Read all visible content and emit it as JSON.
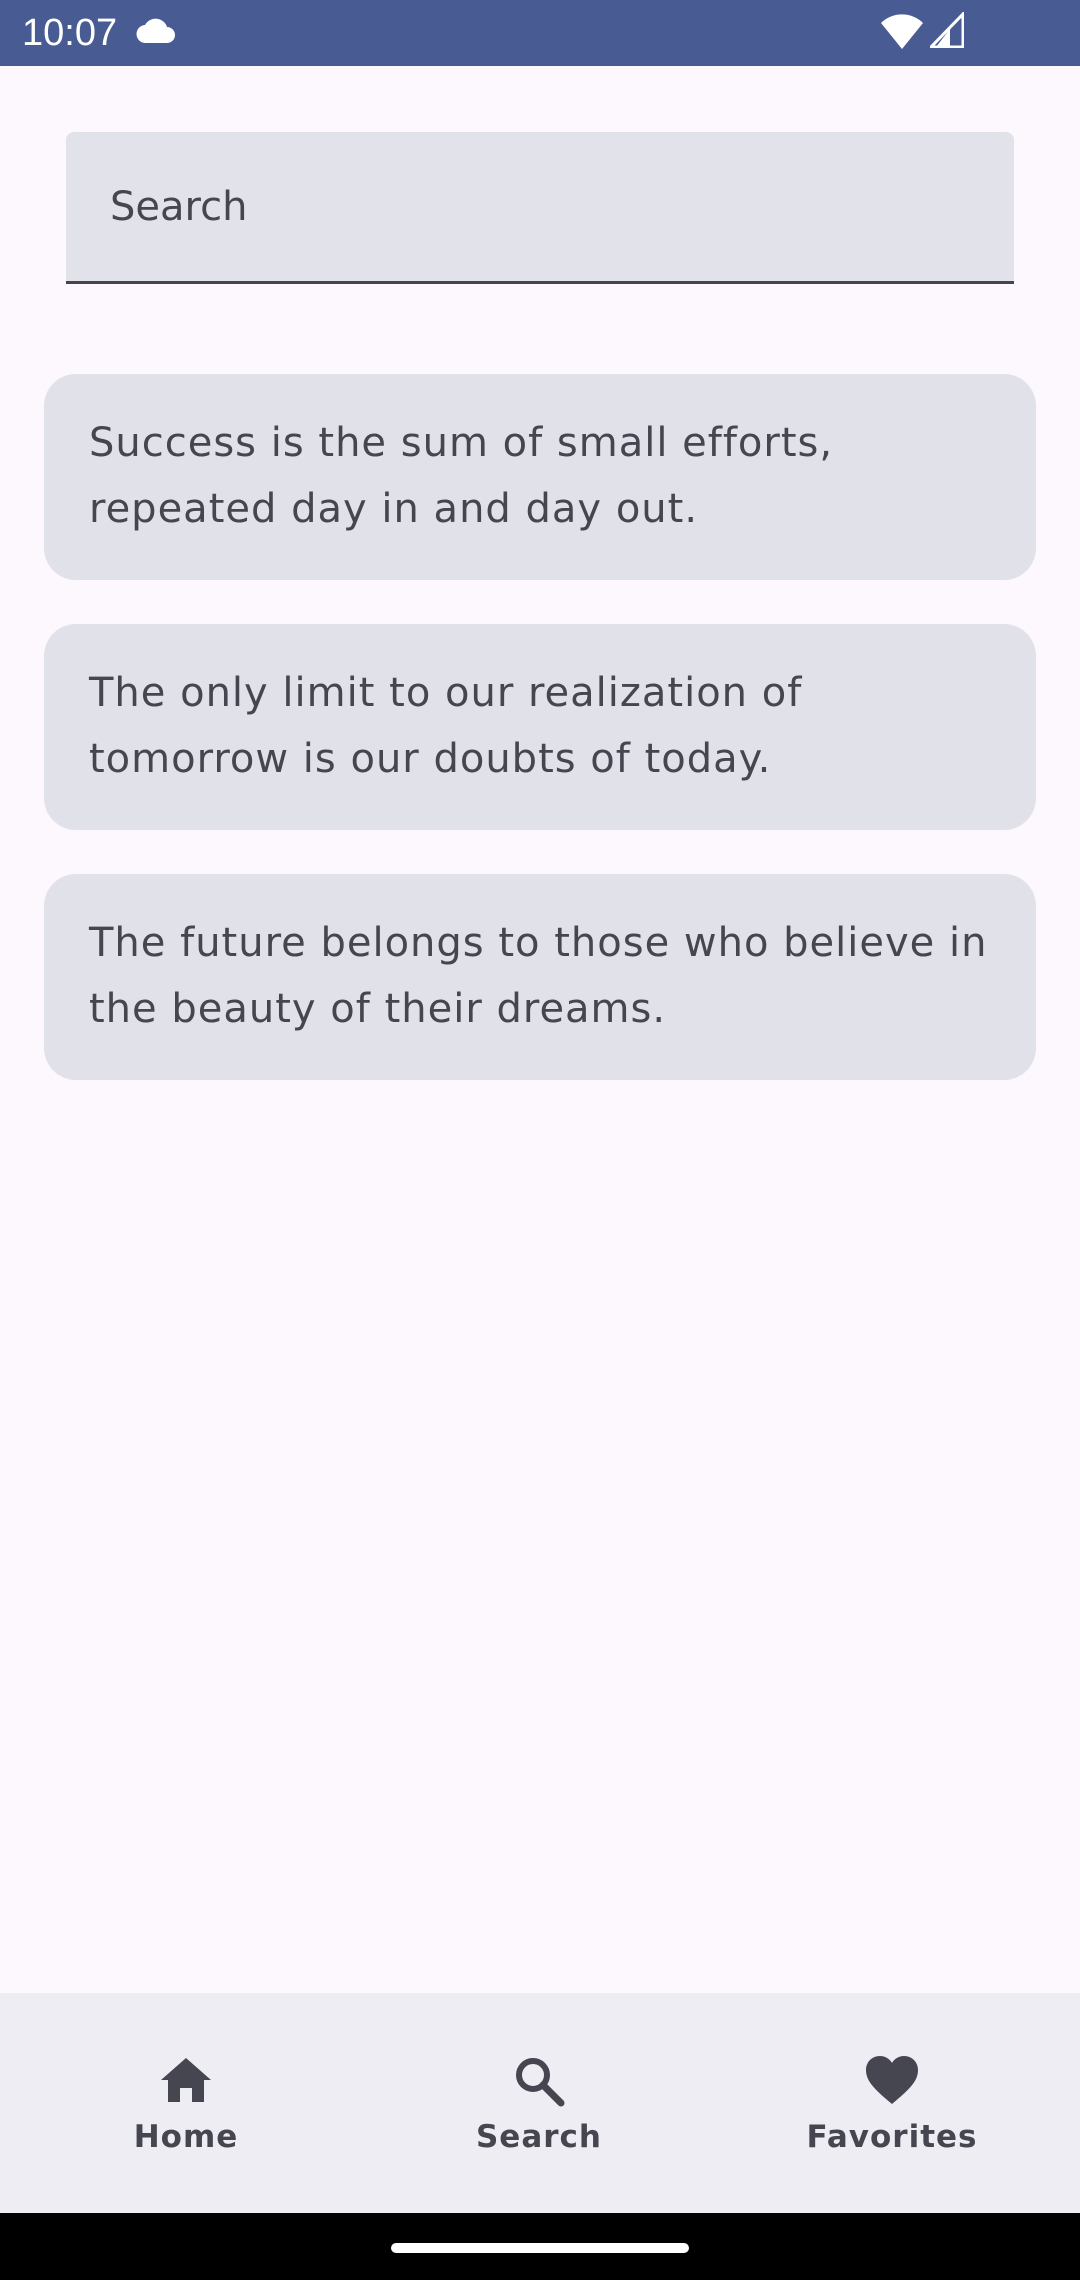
{
  "status_bar": {
    "time": "10:07",
    "background": "#485b92",
    "icons": [
      "cloud-icon",
      "wifi-icon",
      "signal-icon"
    ]
  },
  "search": {
    "placeholder": "Search",
    "value": ""
  },
  "quotes": [
    {
      "text": "Success is the sum of small efforts, repeated day in and day out."
    },
    {
      "text": "The only limit to our realization of tomorrow is our doubts of today."
    },
    {
      "text": "The future belongs to those who believe in the beauty of their dreams."
    }
  ],
  "bottom_nav": {
    "items": [
      {
        "label": "Home",
        "icon": "home-icon"
      },
      {
        "label": "Search",
        "icon": "search-icon"
      },
      {
        "label": "Favorites",
        "icon": "heart-icon"
      }
    ]
  },
  "colors": {
    "background": "#fcf8fd",
    "card": "#e1e1ea",
    "nav_background": "#efedf4",
    "text": "#45464f"
  }
}
